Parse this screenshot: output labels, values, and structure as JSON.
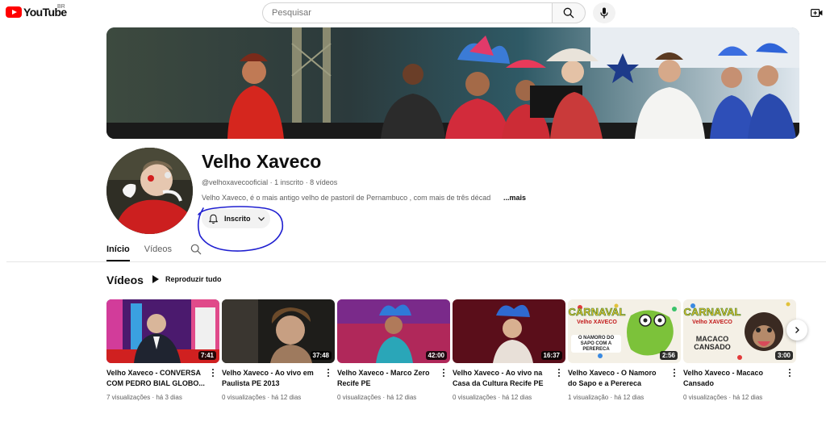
{
  "header": {
    "logo_text": "YouTube",
    "country_code": "BR",
    "search_placeholder": "Pesquisar"
  },
  "channel": {
    "name": "Velho Xaveco",
    "handle": "@velhoxavecooficial",
    "subscribers": "1 inscrito",
    "video_count": "8 vídeos",
    "meta_line": "@velhoxavecooficial · 1 inscrito · 8 vídeos",
    "description": "Velho Xaveco, é o mais antigo velho de pastoril de Pernambuco , com mais de três décad",
    "more_label": "...mais",
    "subscribed_label": "Inscrito"
  },
  "tabs": [
    {
      "label": "Início",
      "active": true
    },
    {
      "label": "Vídeos",
      "active": false
    }
  ],
  "section": {
    "title": "Vídeos",
    "play_all_label": "Reproduzir tudo"
  },
  "videos": [
    {
      "title": "Velho Xaveco - CONVERSA COM PEDRO BIAL GLOBO...",
      "duration": "7:41",
      "meta": "7 visualizações · há 3 dias"
    },
    {
      "title": "Velho Xaveco - Ao vivo em Paulista PE 2013",
      "duration": "37:48",
      "meta": "0 visualizações · há 12 dias"
    },
    {
      "title": "Velho Xaveco - Marco Zero Recife PE",
      "duration": "42:00",
      "meta": "0 visualizações · há 12 dias"
    },
    {
      "title": "Velho Xaveco - Ao vivo na Casa da Cultura Recife PE",
      "duration": "16:37",
      "meta": "0 visualizações · há 12 dias"
    },
    {
      "title": "Velho Xaveco - O Namoro do Sapo e a Perereca",
      "duration": "2:56",
      "meta": "1 visualização · há 12 dias",
      "thumb_text": [
        "CARNAVAL",
        "Velho XAVECO",
        "O NAMORO DO SAPO COM A PERERECA"
      ]
    },
    {
      "title": "Velho Xaveco - Macaco Cansado",
      "duration": "3:00",
      "meta": "0 visualizações · há 12 dias",
      "thumb_text": [
        "CARNAVAL",
        "Velho XAVECO",
        "MACACO CANSADO"
      ]
    }
  ],
  "colors": {
    "brand_red": "#ff0000",
    "annotation_blue": "#1f1fd0",
    "text_primary": "#0f0f0f",
    "text_secondary": "#606060"
  }
}
